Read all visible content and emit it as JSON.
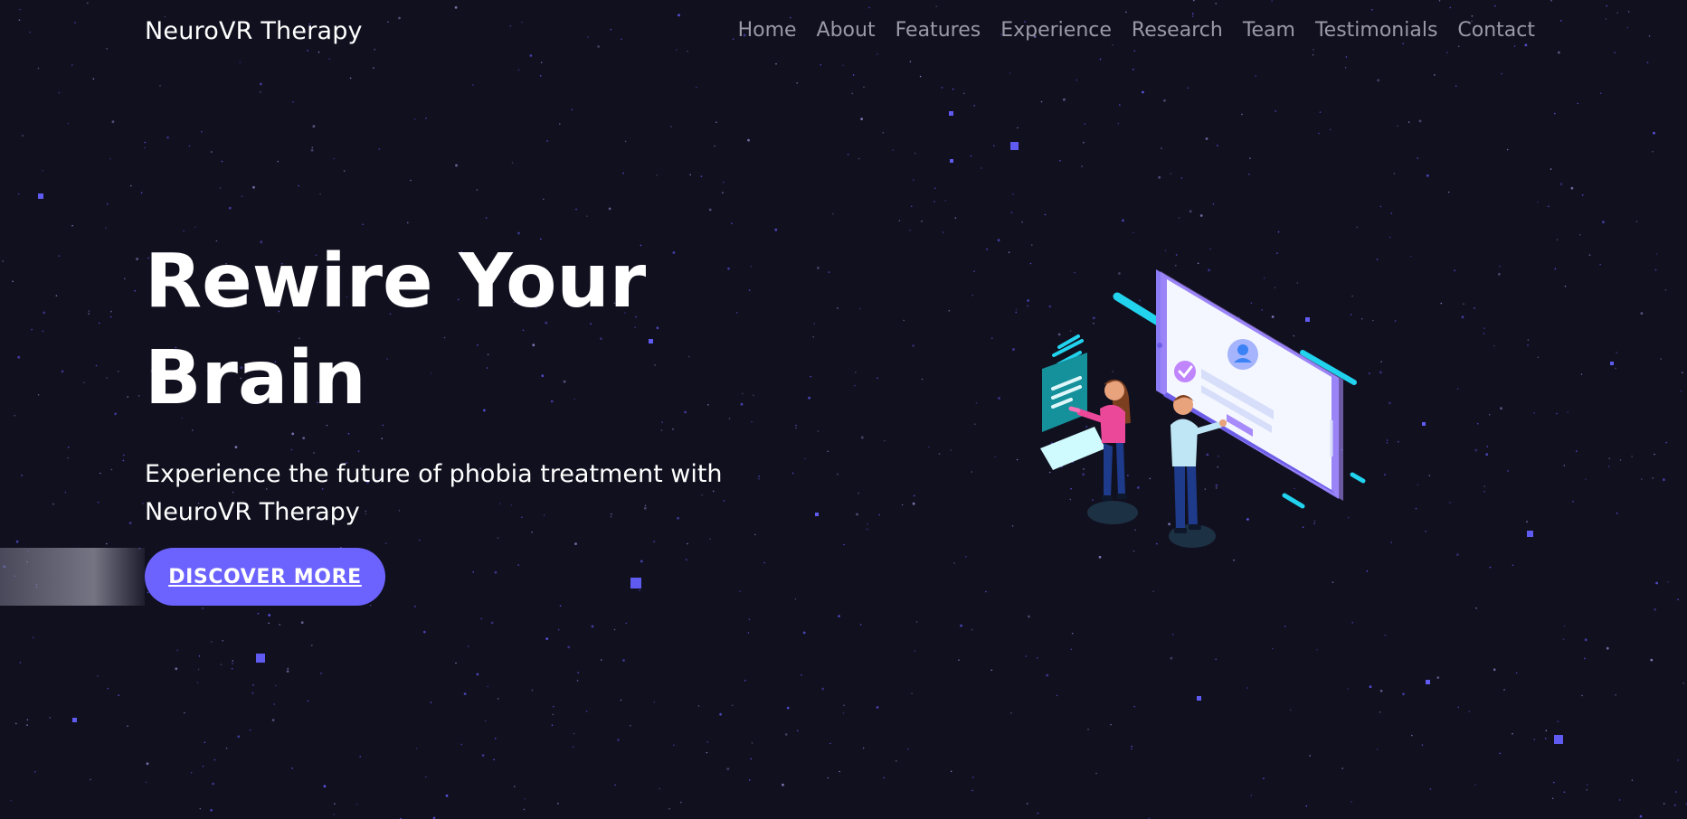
{
  "navbar": {
    "brand": "NeuroVR Therapy",
    "links": [
      {
        "label": "Home"
      },
      {
        "label": "About"
      },
      {
        "label": "Features"
      },
      {
        "label": "Experience"
      },
      {
        "label": "Research"
      },
      {
        "label": "Team"
      },
      {
        "label": "Testimonials"
      },
      {
        "label": "Contact"
      }
    ]
  },
  "hero": {
    "title_line1": "Rewire Your",
    "title_line2": "Brain",
    "subtitle": "Experience the future of phobia treatment with NeuroVR Therapy",
    "cta_label": "DISCOVER MORE"
  },
  "illustration": {
    "icon": "vr-therapy-isometric-illustration"
  },
  "colors": {
    "background": "#11101f",
    "accent": "#6c63ff",
    "nav_text": "#9a99a6",
    "star": "#5f5af0",
    "cyan": "#22d3ee",
    "pink": "#ec4899"
  }
}
